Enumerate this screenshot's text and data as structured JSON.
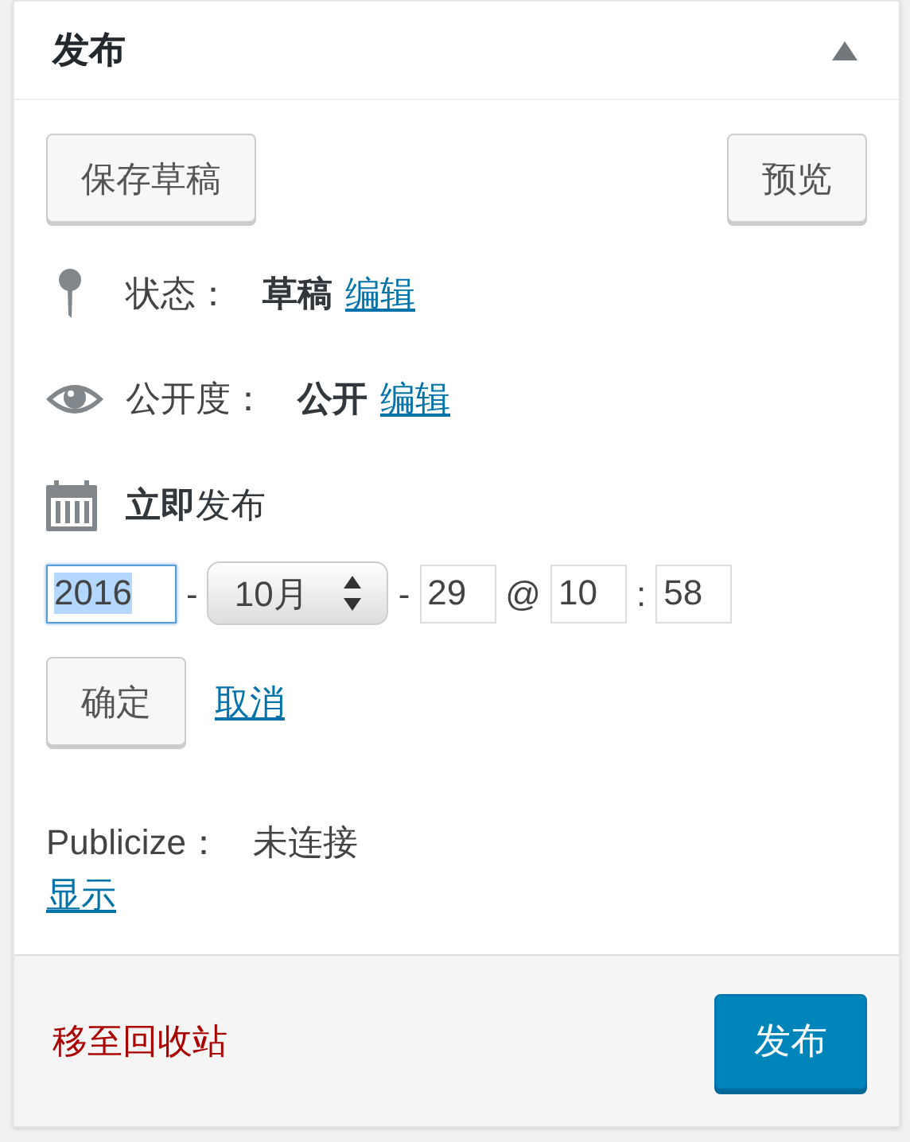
{
  "panel": {
    "title": "发布",
    "expanded": true
  },
  "buttons": [
    {
      "label": "保存草稿"
    },
    {
      "label": "预览"
    }
  ],
  "status": {
    "label": "状态：",
    "value": "草稿",
    "link": "编辑"
  },
  "visibility": {
    "label": "公开度：",
    "value": "公开",
    "link": "编辑"
  },
  "schedule": {
    "label": "**立即**发布",
    "parts": [
      {
        "kind": "year",
        "value": "2016",
        "focused": true
      },
      {
        "kind": "sep",
        "text": "-"
      },
      {
        "kind": "select",
        "value": "10月"
      },
      {
        "kind": "sep",
        "text": "-"
      },
      {
        "kind": "field",
        "value": "29",
        "focused": false
      },
      {
        "kind": "sep",
        "text": "@"
      },
      {
        "kind": "field",
        "value": "10",
        "focused": false
      },
      {
        "kind": "sep",
        "text": ":"
      },
      {
        "kind": "field",
        "value": "58",
        "focused": false
      }
    ],
    "confirm": "确定",
    "cancel": "取消"
  },
  "publicize": {
    "label": "Publicize：",
    "value": "未连接",
    "link": "显示"
  },
  "footer": {
    "trash": "移至回收站",
    "publish": "发布"
  }
}
